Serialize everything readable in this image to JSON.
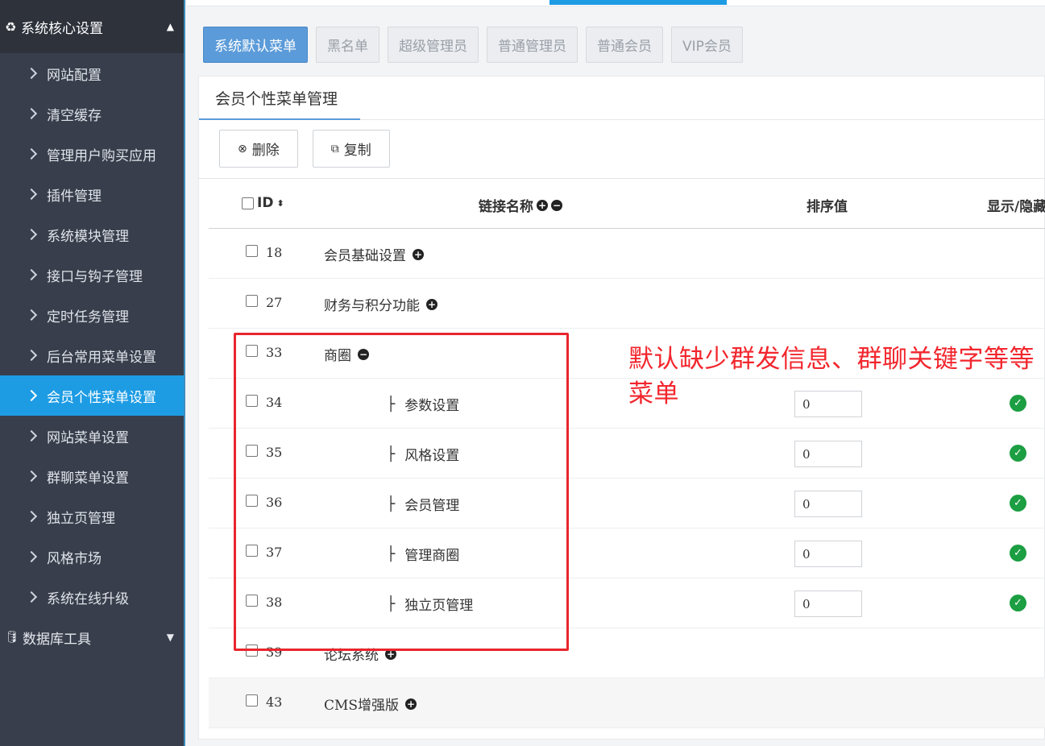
{
  "sidebar": {
    "header": {
      "title": "系统核心设置",
      "icon": "recycle-icon"
    },
    "items": [
      {
        "label": "网站配置"
      },
      {
        "label": "清空缓存"
      },
      {
        "label": "管理用户购买应用"
      },
      {
        "label": "插件管理"
      },
      {
        "label": "系统模块管理"
      },
      {
        "label": "接口与钩子管理"
      },
      {
        "label": "定时任务管理"
      },
      {
        "label": "后台常用菜单设置"
      },
      {
        "label": "会员个性菜单设置",
        "active": true
      },
      {
        "label": "网站菜单设置"
      },
      {
        "label": "群聊菜单设置"
      },
      {
        "label": "独立页管理"
      },
      {
        "label": "风格市场"
      },
      {
        "label": "系统在线升级"
      }
    ],
    "db_section": {
      "title": "数据库工具",
      "icon": "database-icon"
    }
  },
  "tabs": [
    {
      "label": "系统默认菜单",
      "active": true
    },
    {
      "label": "黑名单"
    },
    {
      "label": "超级管理员"
    },
    {
      "label": "普通管理员"
    },
    {
      "label": "普通会员"
    },
    {
      "label": "VIP会员"
    }
  ],
  "panel": {
    "title": "会员个性菜单管理",
    "delete_label": "删除",
    "copy_label": "复制"
  },
  "table": {
    "headers": {
      "id": "ID",
      "name": "链接名称",
      "sort": "排序值",
      "visible": "显示/隐藏"
    },
    "rows": [
      {
        "id": "18",
        "name": "会员基础设置",
        "expand": "+"
      },
      {
        "id": "27",
        "name": "财务与积分功能",
        "expand": "+"
      },
      {
        "id": "33",
        "name": "商圈",
        "expand": "-"
      },
      {
        "id": "34",
        "name": "参数设置",
        "child": true,
        "sort": "0"
      },
      {
        "id": "35",
        "name": "风格设置",
        "child": true,
        "sort": "0"
      },
      {
        "id": "36",
        "name": "会员管理",
        "child": true,
        "sort": "0"
      },
      {
        "id": "37",
        "name": "管理商圈",
        "child": true,
        "sort": "0"
      },
      {
        "id": "38",
        "name": "独立页管理",
        "child": true,
        "sort": "0"
      },
      {
        "id": "39",
        "name": "论坛系统",
        "expand": "+"
      },
      {
        "id": "43",
        "name": "CMS增强版",
        "expand": "+"
      }
    ]
  },
  "annotation": {
    "text": "默认缺少群发信息、群聊关键字等等菜单",
    "color": "#f2262d"
  },
  "colors": {
    "accent": "#1d9ce4",
    "tab_active": "#5b9bd9",
    "sidebar_bg": "#383e4b",
    "ok_green": "#1c9e42"
  }
}
